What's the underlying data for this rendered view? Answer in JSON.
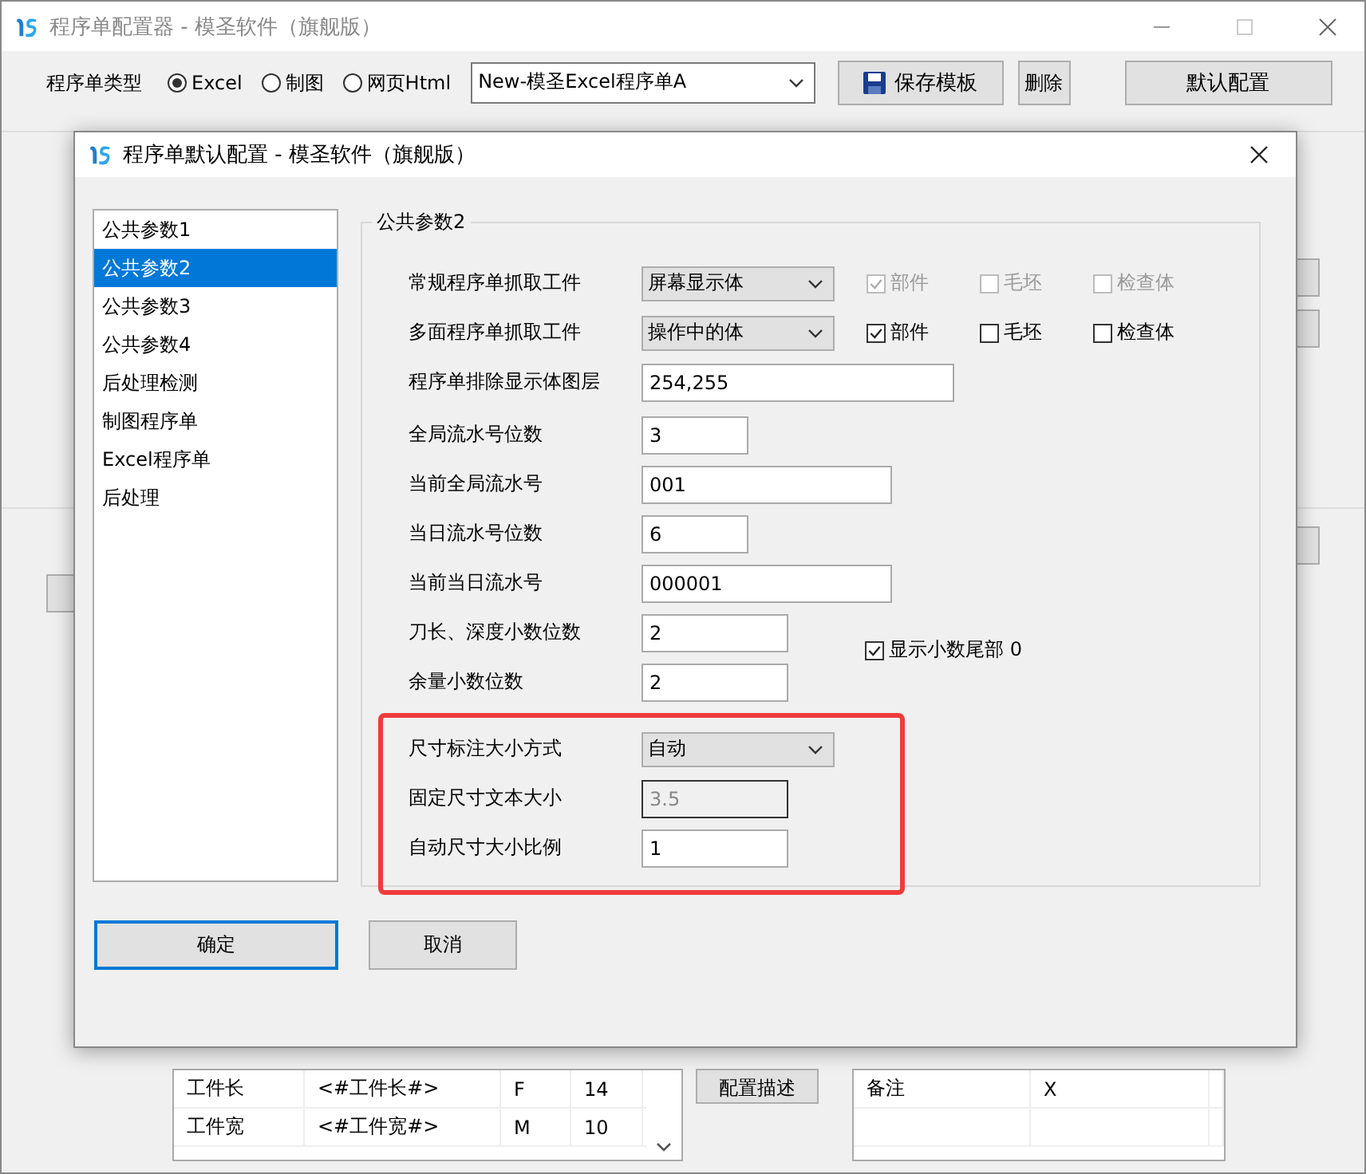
{
  "window": {
    "title": "程序单配置器 - 模圣软件（旗舰版）"
  },
  "toolbar": {
    "label": "程序单类型",
    "radios": [
      {
        "label": "Excel",
        "selected": true
      },
      {
        "label": "制图",
        "selected": false
      },
      {
        "label": "网页Html",
        "selected": false
      }
    ],
    "template_select": {
      "value": "New-模圣Excel程序单A"
    },
    "save_button": "保存模板",
    "delete_button": "删除",
    "default_button": "默认配置"
  },
  "background": {
    "table_rows": [
      [
        "工件长",
        "<#工件长#>",
        "F",
        "14"
      ],
      [
        "工件宽",
        "<#工件宽#>",
        "M",
        "10"
      ]
    ],
    "describe_button": "配置描述",
    "notes_rows": [
      [
        "备注",
        "X"
      ]
    ]
  },
  "dialog": {
    "title": "程序单默认配置 - 模圣软件（旗舰版）",
    "nav": [
      {
        "label": "公共参数1",
        "selected": false
      },
      {
        "label": "公共参数2",
        "selected": true
      },
      {
        "label": "公共参数3",
        "selected": false
      },
      {
        "label": "公共参数4",
        "selected": false
      },
      {
        "label": "后处理检测",
        "selected": false
      },
      {
        "label": "制图程序单",
        "selected": false
      },
      {
        "label": "Excel程序单",
        "selected": false
      },
      {
        "label": "后处理",
        "selected": false
      }
    ],
    "group_title": "公共参数2",
    "fields": [
      {
        "kind": "select",
        "label": "常规程序单抓取工件",
        "value": "屏幕显示体",
        "checks": [
          {
            "label": "部件",
            "checked": true,
            "disabled": true
          },
          {
            "label": "毛坯",
            "checked": false,
            "disabled": true
          },
          {
            "label": "检查体",
            "checked": false,
            "disabled": true
          }
        ]
      },
      {
        "kind": "select",
        "label": "多面程序单抓取工件",
        "value": "操作中的体",
        "checks": [
          {
            "label": "部件",
            "checked": true,
            "disabled": false
          },
          {
            "label": "毛坯",
            "checked": false,
            "disabled": false
          },
          {
            "label": "检查体",
            "checked": false,
            "disabled": false
          }
        ]
      },
      {
        "kind": "input",
        "label": "程序单排除显示体图层",
        "value": "254,255"
      },
      {
        "kind": "input",
        "label": "全局流水号位数",
        "value": "3"
      },
      {
        "kind": "input",
        "label": "当前全局流水号",
        "value": "001"
      },
      {
        "kind": "input",
        "label": "当日流水号位数",
        "value": "6"
      },
      {
        "kind": "input",
        "label": "当前当日流水号",
        "value": "000001"
      },
      {
        "kind": "input",
        "label": "刀长、深度小数位数",
        "value": "2",
        "checks": [
          {
            "label": "显示小数尾部 0",
            "checked": true,
            "disabled": false
          }
        ]
      },
      {
        "kind": "input",
        "label": "余量小数位数",
        "value": "2"
      }
    ],
    "highlighted_fields": [
      {
        "kind": "select",
        "label": "尺寸标注大小方式",
        "value": "自动"
      },
      {
        "kind": "input",
        "label": "固定尺寸文本大小",
        "value": "3.5",
        "disabled": true
      },
      {
        "kind": "input",
        "label": "自动尺寸大小比例",
        "value": "1"
      }
    ],
    "ok_button": "确定",
    "cancel_button": "取消"
  }
}
